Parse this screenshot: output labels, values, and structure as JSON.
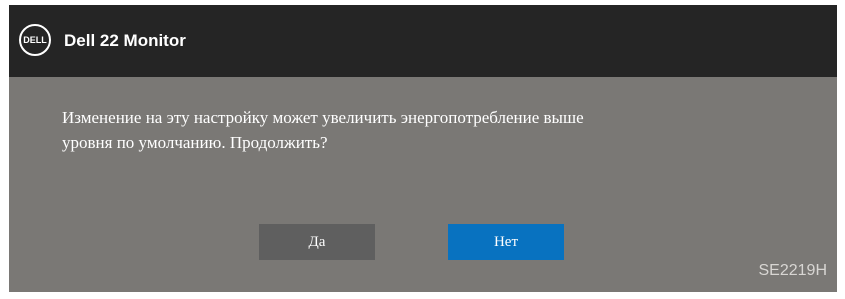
{
  "header": {
    "logo_text": "DELL",
    "title": "Dell 22 Monitor"
  },
  "dialog": {
    "message_line1": "Изменение на эту настройку может увеличить энергопотребление выше",
    "message_line2": "уровня по умолчанию. Продолжить?",
    "yes_label": "Да",
    "no_label": "Нет",
    "selected": "Нет"
  },
  "footer": {
    "model": "SE2219H"
  },
  "colors": {
    "titlebar": "#252525",
    "panel": "#7a7875",
    "button_default": "#5f5f5f",
    "button_selected": "#0872c0"
  }
}
